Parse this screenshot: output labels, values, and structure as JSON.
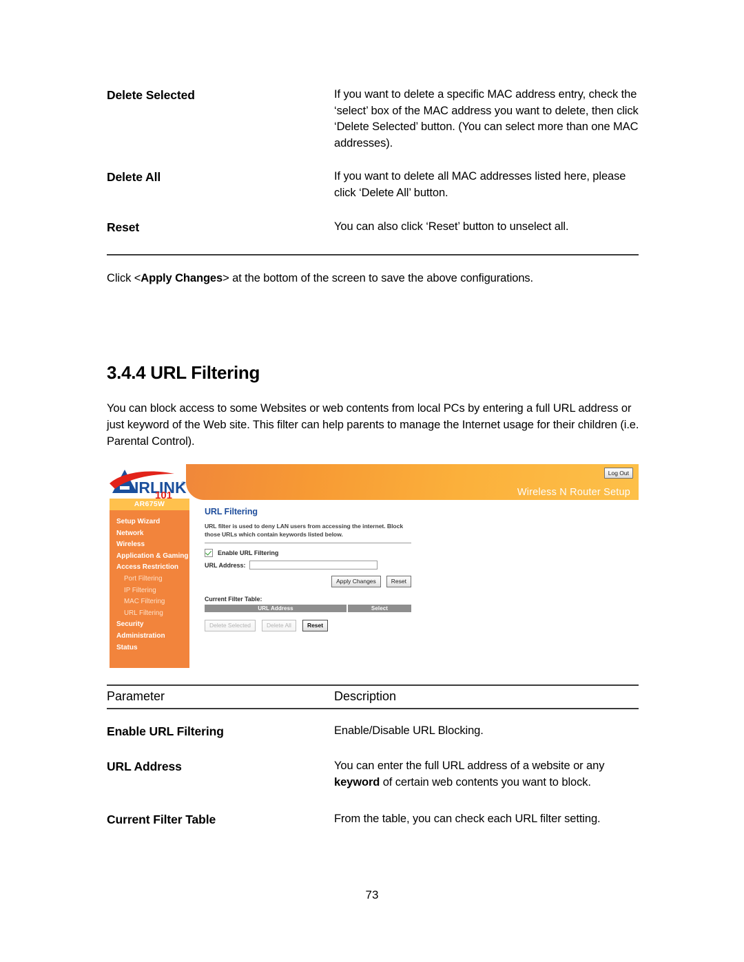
{
  "section_top": {
    "rows": [
      {
        "parameter": "Delete Selected",
        "description": "If you want to delete a specific MAC address entry, check the ‘select’ box of the MAC address you want to delete, then click ‘Delete Selected’ button. (You can select more than one MAC addresses)."
      },
      {
        "parameter": "Delete All",
        "description": "If you want to delete all MAC addresses listed here, please click ‘Delete All’ button."
      },
      {
        "parameter": "Reset",
        "description": "You can also click ‘Reset’ button to unselect all."
      }
    ]
  },
  "apply_note": {
    "before": "Click <",
    "bold": "Apply Changes",
    "after": "> at the bottom of the screen to save the above configurations."
  },
  "heading": "3.4.4 URL Filtering",
  "intro": "You can block access to some Websites or web contents from local PCs by entering a full URL address or just keyword of the Web site. This filter can help parents to manage the Internet usage for their children (i.e. Parental Control).",
  "screenshot": {
    "logo": {
      "brand_air": "A",
      "brand_text": "IRLINK",
      "registered": "®",
      "sub": "101"
    },
    "logout_label": "Log Out",
    "router_title": "Wireless N Router Setup",
    "model": "AR675W",
    "menu": [
      {
        "label": "Setup Wizard",
        "sub": false
      },
      {
        "label": "Network",
        "sub": false
      },
      {
        "label": "Wireless",
        "sub": false
      },
      {
        "label": "Application & Gaming",
        "sub": false
      },
      {
        "label": "Access Restriction",
        "sub": false
      },
      {
        "label": "Port Filtering",
        "sub": true
      },
      {
        "label": "IP Filtering",
        "sub": true
      },
      {
        "label": "MAC Filtering",
        "sub": true
      },
      {
        "label": "URL Filtering",
        "sub": true
      },
      {
        "label": "Security",
        "sub": false
      },
      {
        "label": "Administration",
        "sub": false
      },
      {
        "label": "Status",
        "sub": false
      }
    ],
    "pane": {
      "title": "URL Filtering",
      "description": "URL filter is used to deny LAN users from accessing the internet. Block those URLs which contain keywords listed below.",
      "enable_label": "Enable URL Filtering",
      "enable_checked": true,
      "url_address_label": "URL Address:",
      "url_address_value": "",
      "apply_label": "Apply Changes",
      "reset_label": "Reset",
      "current_filter_label": "Current Filter Table:",
      "col_url": "URL Address",
      "col_select": "Select",
      "delete_selected_label": "Delete Selected",
      "delete_all_label": "Delete All",
      "reset2_label": "Reset"
    },
    "colors": {
      "header_left": "#f0873a",
      "header_right": "#fdc049",
      "sidebar": "#f2843c",
      "model_bar": "#ffc14d",
      "pane_title": "#1f4e9c",
      "table_header": "#8e8e8e",
      "checkbox_check": "#2e9a2e",
      "logo_blue": "#1b4f9c",
      "logo_red": "#e2231a"
    }
  },
  "param_table": {
    "col_parameter": "Parameter",
    "col_description": "Description",
    "rows": [
      {
        "parameter": "Enable URL Filtering",
        "description": "Enable/Disable URL Blocking."
      },
      {
        "parameter": "URL Address",
        "description_before": "You can enter the full URL address of a website or any ",
        "description_bold": "keyword",
        "description_after": " of certain web contents you want to block."
      },
      {
        "parameter": "Current Filter Table",
        "description": "From the table, you can check each URL filter setting."
      }
    ]
  },
  "page_number": "73"
}
